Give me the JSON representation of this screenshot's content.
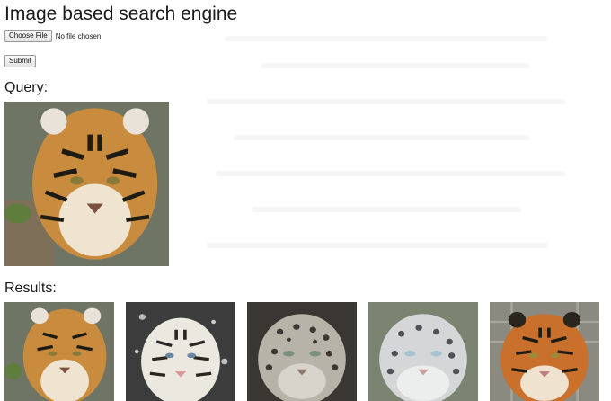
{
  "page": {
    "title": "Image based search engine"
  },
  "upload": {
    "choose_file_label": "Choose File",
    "file_status": "No file chosen",
    "submit_label": "Submit"
  },
  "query": {
    "label": "Query:",
    "image": {
      "subject": "tiger-face"
    }
  },
  "results": {
    "label": "Results:",
    "images": [
      {
        "subject": "tiger-face"
      },
      {
        "subject": "white-tiger-face"
      },
      {
        "subject": "snow-leopard-face"
      },
      {
        "subject": "snow-leopard-face"
      },
      {
        "subject": "tiger-face"
      }
    ]
  },
  "colors": {
    "tiger_orange": "#c9893a",
    "snow_leopard_gray": "#b9b9b4",
    "text": "#1a1a1a"
  }
}
